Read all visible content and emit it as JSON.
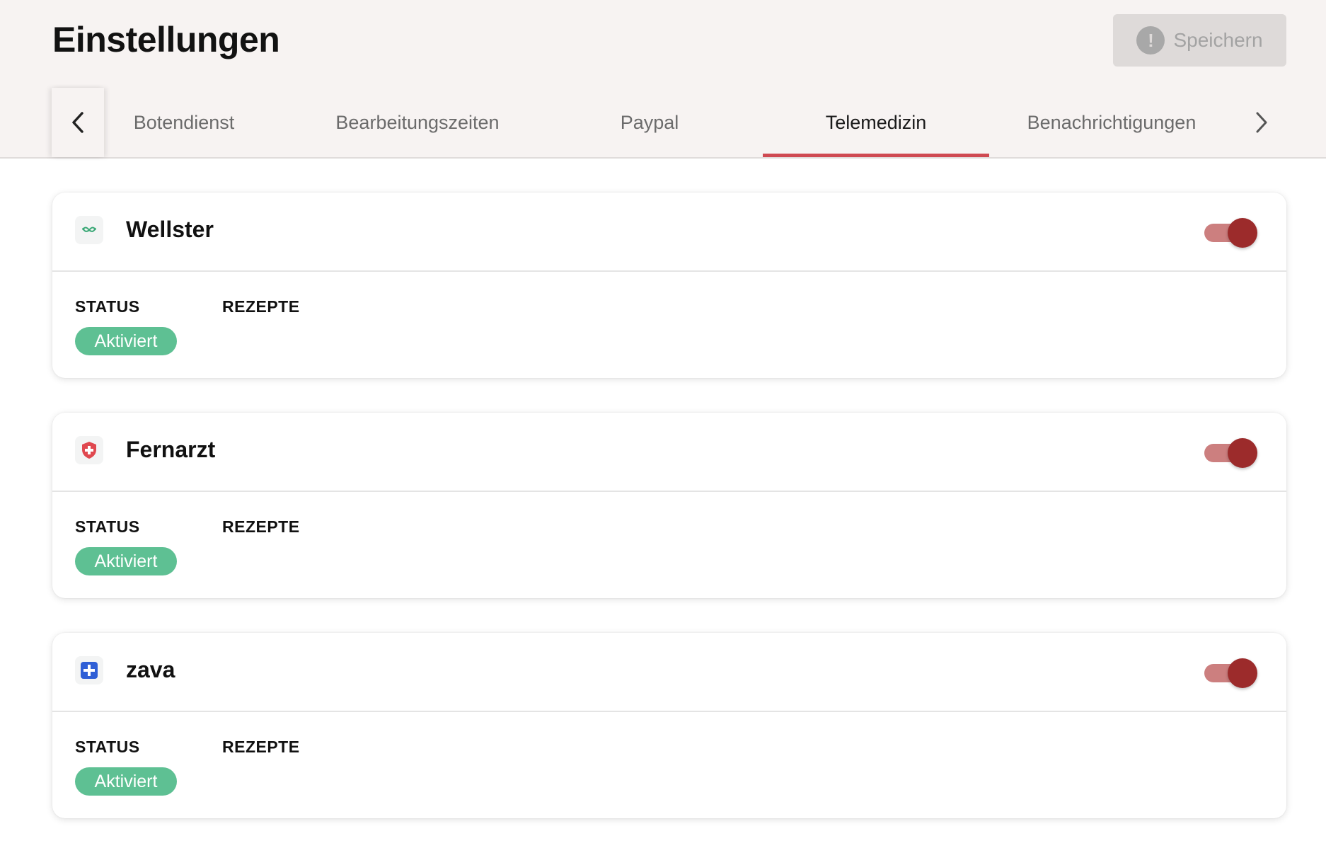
{
  "header": {
    "title": "Einstellungen",
    "save_label": "Speichern"
  },
  "tabs": [
    {
      "label": "Botendienst",
      "active": false
    },
    {
      "label": "Bearbeitungszeiten",
      "active": false
    },
    {
      "label": "Paypal",
      "active": false
    },
    {
      "label": "Telemedizin",
      "active": true
    },
    {
      "label": "Benachrichtigungen",
      "active": false
    }
  ],
  "labels": {
    "status": "STATUS",
    "rezepte": "REZEPTE"
  },
  "providers": [
    {
      "name": "Wellster",
      "status": "Aktiviert",
      "enabled": true,
      "icon": "wellster-logo-icon"
    },
    {
      "name": "Fernarzt",
      "status": "Aktiviert",
      "enabled": true,
      "icon": "fernarzt-shield-icon"
    },
    {
      "name": "zava",
      "status": "Aktiviert",
      "enabled": true,
      "icon": "zava-cross-icon"
    }
  ],
  "colors": {
    "accent": "#cf4a52",
    "toggle_knob": "#9c2b2b",
    "toggle_track": "#cc7f7f",
    "status_badge": "#5ec093"
  }
}
